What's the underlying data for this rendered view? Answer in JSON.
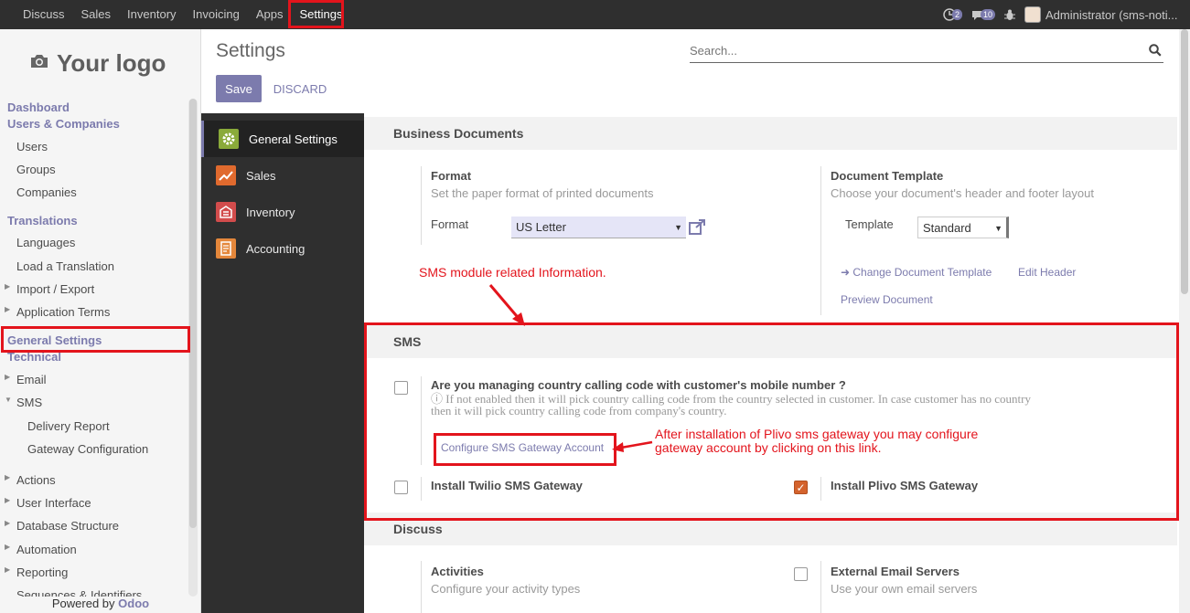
{
  "topbar": {
    "menu": [
      "Discuss",
      "Sales",
      "Inventory",
      "Invoicing",
      "Apps",
      "Settings"
    ],
    "activities_count": "2",
    "messages_count": "10",
    "user": "Administrator (sms-noti..."
  },
  "sidebar": {
    "logo_text": "Your logo",
    "dashboard": "Dashboard",
    "users_companies": "Users & Companies",
    "users": "Users",
    "groups": "Groups",
    "companies": "Companies",
    "translations": "Translations",
    "languages": "Languages",
    "load_translation": "Load a Translation",
    "import_export": "Import / Export",
    "application_terms": "Application Terms",
    "general_settings": "General Settings",
    "technical": "Technical",
    "email": "Email",
    "sms": "SMS",
    "delivery_report": "Delivery Report",
    "gateway_configuration": "Gateway Configuration",
    "actions": "Actions",
    "user_interface": "User Interface",
    "database_structure": "Database Structure",
    "automation": "Automation",
    "reporting": "Reporting",
    "sequences": "Sequences & Identifiers",
    "powered_by": "Powered by",
    "powered_brand": "Odoo"
  },
  "control_panel": {
    "title": "Settings",
    "save_label": "Save",
    "discard_label": "DISCARD",
    "search_placeholder": "Search..."
  },
  "settings_nav": [
    "General Settings",
    "Sales",
    "Inventory",
    "Accounting"
  ],
  "business_documents": {
    "heading": "Business Documents",
    "format_title": "Format",
    "format_desc": "Set the paper format of printed documents",
    "format_label": "Format",
    "format_value": "US Letter",
    "template_title": "Document Template",
    "template_desc": "Choose your document's header and footer layout",
    "template_label": "Template",
    "template_value": "Standard",
    "change_template": "Change Document Template",
    "edit_header": "Edit Header",
    "preview_document": "Preview Document"
  },
  "sms": {
    "heading": "SMS",
    "country_code_title": "Are you managing country calling code with customer's mobile number ?",
    "country_code_help_1": "If not enabled then it will pick country calling code from the country selected in customer. In case customer has no country",
    "country_code_help_2": "then it will pick country calling code from company's country.",
    "configure_link": "Configure SMS Gateway Account",
    "twilio": "Install Twilio SMS Gateway",
    "plivo": "Install Plivo SMS Gateway",
    "twilio_checked": false,
    "plivo_checked": true,
    "country_code_checked": false
  },
  "discuss": {
    "heading": "Discuss",
    "activities_title": "Activities",
    "activities_desc": "Configure your activity types",
    "email_servers_title": "External Email Servers",
    "email_servers_desc": "Use your own email servers"
  },
  "annotations": {
    "sms_info": "SMS module related Information.",
    "plivo_info_1": "After installation of Plivo sms gateway you may configure",
    "plivo_info_2": "gateway account by clicking on this link."
  },
  "colors": {
    "accent": "#7c7bad",
    "topbar": "#2f2f2f",
    "annotation_red": "#e3141c",
    "checkbox_on": "#d4632d"
  }
}
